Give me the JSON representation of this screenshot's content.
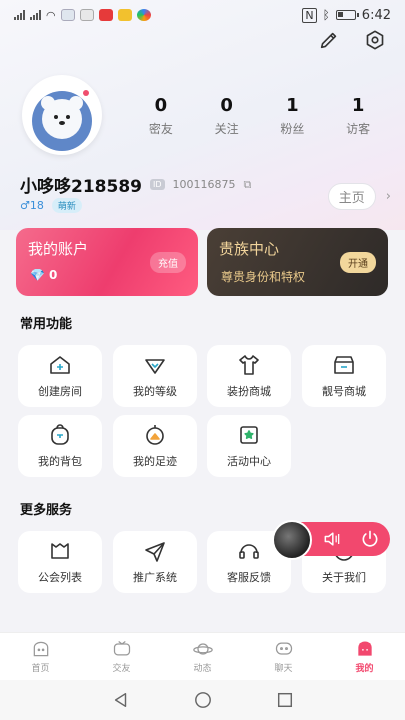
{
  "statusbar": {
    "time": "6:42"
  },
  "profile": {
    "username": "小哆哆218589",
    "id_badge": "ID",
    "id_number": "100116875",
    "gender_age": "♂18",
    "level_tag": "萌新",
    "homepage_label": "主页"
  },
  "stats": [
    {
      "value": "0",
      "label": "密友"
    },
    {
      "value": "0",
      "label": "关注"
    },
    {
      "value": "1",
      "label": "粉丝"
    },
    {
      "value": "1",
      "label": "访客"
    }
  ],
  "account_card": {
    "title": "我的账户",
    "diamonds": "0",
    "button": "充值"
  },
  "noble_card": {
    "title": "贵族中心",
    "subtitle": "尊贵身份和特权",
    "button": "开通"
  },
  "common": {
    "title": "常用功能",
    "items": [
      {
        "label": "创建房间",
        "icon": "house-icon"
      },
      {
        "label": "我的等级",
        "icon": "level-icon"
      },
      {
        "label": "装扮商城",
        "icon": "shirt-icon"
      },
      {
        "label": "靓号商城",
        "icon": "shop-icon"
      },
      {
        "label": "我的背包",
        "icon": "backpack-icon"
      },
      {
        "label": "我的足迹",
        "icon": "footprint-icon"
      },
      {
        "label": "活动中心",
        "icon": "activity-icon"
      }
    ]
  },
  "more": {
    "title": "更多服务",
    "items": [
      {
        "label": "公会列表",
        "icon": "guild-icon"
      },
      {
        "label": "推广系统",
        "icon": "send-icon"
      },
      {
        "label": "客服反馈",
        "icon": "headset-icon"
      },
      {
        "label": "关于我们",
        "icon": "info-icon"
      }
    ]
  },
  "tabs": [
    {
      "label": "首页",
      "icon": "home-icon"
    },
    {
      "label": "交友",
      "icon": "tv-icon"
    },
    {
      "label": "动态",
      "icon": "planet-icon"
    },
    {
      "label": "聊天",
      "icon": "chat-icon"
    },
    {
      "label": "我的",
      "icon": "me-icon",
      "active": true
    }
  ],
  "colors": {
    "accent": "#f2486e",
    "noble_gold": "#f1d49b"
  }
}
